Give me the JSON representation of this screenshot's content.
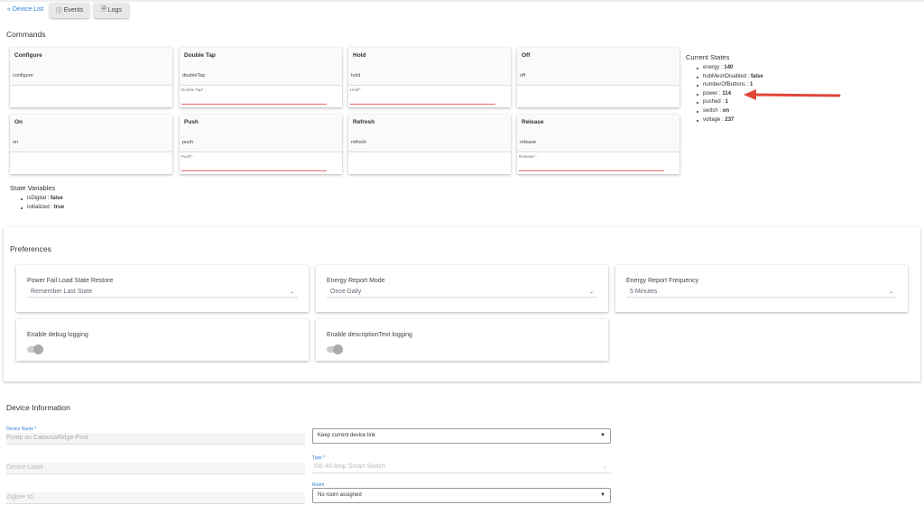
{
  "nav": {
    "back": "« Device List",
    "events": "Events",
    "logs": "Logs",
    "events_icon": "info-circle-icon",
    "logs_icon": "document-icon"
  },
  "commands": {
    "title": "Commands",
    "items": [
      {
        "title": "Configure",
        "name": "configure",
        "param": ""
      },
      {
        "title": "Double Tap",
        "name": "doubleTap",
        "param": "Double Tap* :"
      },
      {
        "title": "Hold",
        "name": "hold",
        "param": "Hold* :"
      },
      {
        "title": "Off",
        "name": "off",
        "param": ""
      },
      {
        "title": "On",
        "name": "on",
        "param": ""
      },
      {
        "title": "Push",
        "name": "push",
        "param": "Push* :"
      },
      {
        "title": "Refresh",
        "name": "refresh",
        "param": ""
      },
      {
        "title": "Release",
        "name": "release",
        "param": "Release* :"
      }
    ]
  },
  "current_states": {
    "title": "Current States",
    "items": [
      {
        "key": "energy",
        "value": "140"
      },
      {
        "key": "hubMeshDisabled",
        "value": "false"
      },
      {
        "key": "numberOfButtons",
        "value": "1"
      },
      {
        "key": "power",
        "value": "114"
      },
      {
        "key": "pushed",
        "value": "1"
      },
      {
        "key": "switch",
        "value": "on"
      },
      {
        "key": "voltage",
        "value": "237"
      }
    ],
    "annotation_color": "#e0463a"
  },
  "state_variables": {
    "title": "State Variables",
    "items": [
      {
        "key": "isDigital",
        "value": "false"
      },
      {
        "key": "initialized",
        "value": "true"
      }
    ]
  },
  "preferences": {
    "title": "Preferences",
    "selects": [
      {
        "label": "Power Fail Load State Restore",
        "value": "Remember Last State"
      },
      {
        "label": "Energy Report Mode",
        "value": "Once Daily"
      },
      {
        "label": "Energy Report Frequency",
        "value": "5 Minutes"
      }
    ],
    "toggles": [
      {
        "label": "Enable debug logging",
        "on": false
      },
      {
        "label": "Enable descriptionText logging",
        "on": false
      }
    ]
  },
  "device_info": {
    "title": "Device Information",
    "device_name_label": "Device Name *",
    "device_name": "Pump on CatoosaRidge-Pool",
    "device_label_placeholder": "Device Label",
    "zigbee_placeholder": "Zigbee Id",
    "link_select": "Keep current device link",
    "type_label": "Type *",
    "type_value": "GE 40 Amp Smart Switch",
    "room_label": "Room",
    "room_value": "No room assigned"
  }
}
